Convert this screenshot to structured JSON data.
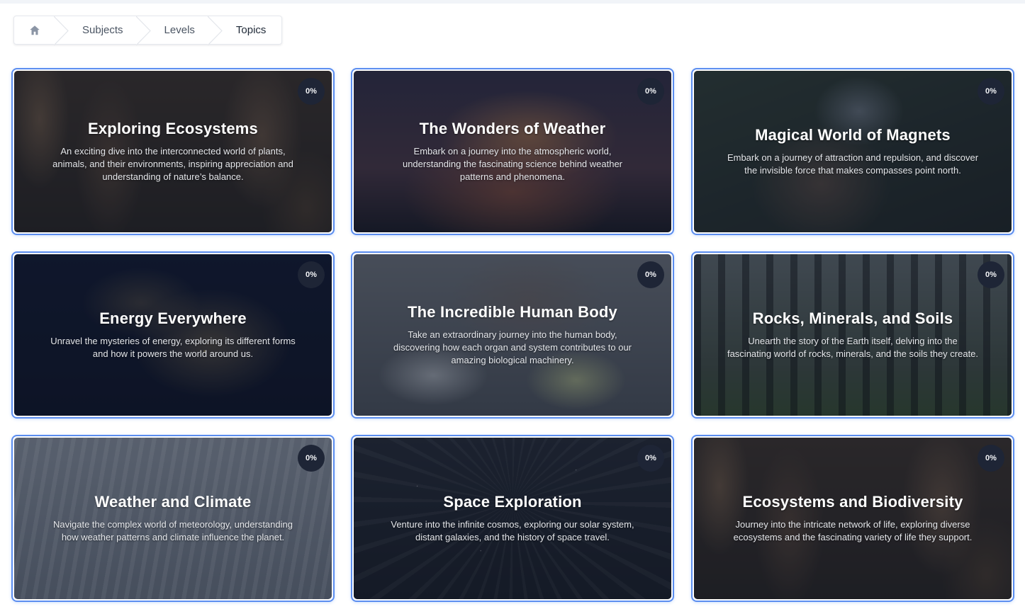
{
  "breadcrumb": {
    "home_icon": "home-icon",
    "items": [
      "Subjects",
      "Levels",
      "Topics"
    ]
  },
  "colors": {
    "card_border": "#5b8def",
    "badge_bg": "#1e2536"
  },
  "cards": [
    {
      "title": "Exploring Ecosystems",
      "description": "An exciting dive into the interconnected world of plants, animals, and their environments, inspiring appreciation and understanding of nature’s balance.",
      "progress": "0%"
    },
    {
      "title": "The Wonders of Weather",
      "description": "Embark on a journey into the atmospheric world, understanding the fascinating science behind weather patterns and phenomena.",
      "progress": "0%"
    },
    {
      "title": "Magical World of Magnets",
      "description": "Embark on a journey of attraction and repulsion, and discover the invisible force that makes compasses point north.",
      "progress": "0%"
    },
    {
      "title": "Energy Everywhere",
      "description": "Unravel the mysteries of energy, exploring its different forms and how it powers the world around us.",
      "progress": "0%"
    },
    {
      "title": "The Incredible Human Body",
      "description": "Take an extraordinary journey into the human body, discovering how each organ and system contributes to our amazing biological machinery.",
      "progress": "0%"
    },
    {
      "title": "Rocks, Minerals, and Soils",
      "description": "Unearth the story of the Earth itself, delving into the fascinating world of rocks, minerals, and the soils they create.",
      "progress": "0%"
    },
    {
      "title": "Weather and Climate",
      "description": "Navigate the complex world of meteorology, understanding how weather patterns and climate influence the planet.",
      "progress": "0%"
    },
    {
      "title": "Space Exploration",
      "description": "Venture into the infinite cosmos, exploring our solar system, distant galaxies, and the history of space travel.",
      "progress": "0%"
    },
    {
      "title": "Ecosystems and Biodiversity",
      "description": "Journey into the intricate network of life, exploring diverse ecosystems and the fascinating variety of life they support.",
      "progress": "0%"
    }
  ]
}
